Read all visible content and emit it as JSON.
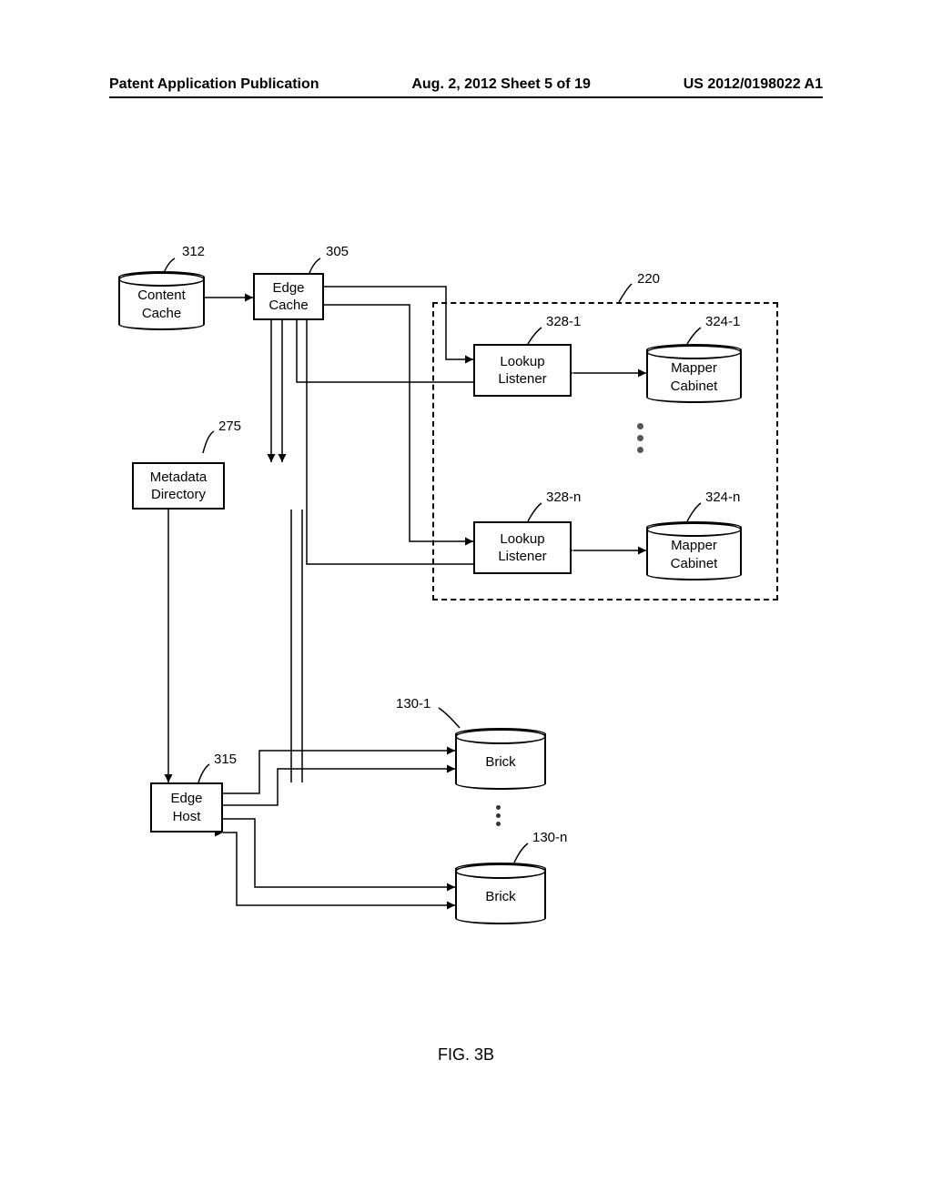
{
  "header": {
    "left": "Patent Application Publication",
    "center": "Aug. 2, 2012  Sheet 5 of 19",
    "right": "US 2012/0198022 A1"
  },
  "refs": {
    "content_cache": "312",
    "edge_cache": "305",
    "metadata_dir": "275",
    "edge_host": "315",
    "lookup_1": "328-1",
    "mapper_1": "324-1",
    "lookup_n": "328-n",
    "mapper_n": "324-n",
    "brick_1": "130-1",
    "brick_n": "130-n",
    "container": "220"
  },
  "boxes": {
    "content_cache": "Content\nCache",
    "edge_cache": "Edge\nCache",
    "metadata_dir": "Metadata\nDirectory",
    "edge_host": "Edge\nHost",
    "lookup1": "Lookup\nListener",
    "mapper1": "Mapper\nCabinet",
    "lookupn": "Lookup\nListener",
    "mappern": "Mapper\nCabinet",
    "brick1": "Brick",
    "brickn": "Brick"
  },
  "figure": "FIG. 3B"
}
